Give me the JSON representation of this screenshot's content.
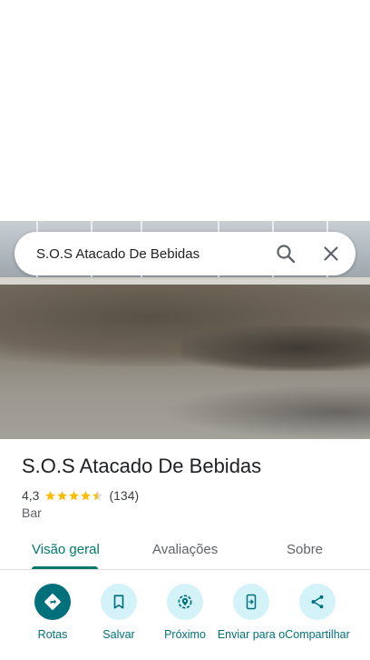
{
  "search": {
    "query": "S.O.S Atacado De Bebidas"
  },
  "place": {
    "name": "S.O.S Atacado De Bebidas",
    "rating": "4,3",
    "stars_value": 4.3,
    "reviews": "(134)",
    "category": "Bar"
  },
  "tabs": [
    {
      "label": "Visão geral",
      "active": true
    },
    {
      "label": "Avaliações",
      "active": false
    },
    {
      "label": "Sobre",
      "active": false
    }
  ],
  "actions": [
    {
      "label": "Rotas",
      "icon": "directions-icon"
    },
    {
      "label": "Salvar",
      "icon": "bookmark-icon"
    },
    {
      "label": "Próximo",
      "icon": "nearby-icon"
    },
    {
      "label": "Enviar para o",
      "icon": "send-to-phone-icon"
    },
    {
      "label": "Compartilhar",
      "icon": "share-icon"
    }
  ],
  "colors": {
    "accent": "#00707a",
    "tab_active": "#00796b",
    "star": "#fbbc04",
    "action_bg": "#d4f3f8"
  }
}
